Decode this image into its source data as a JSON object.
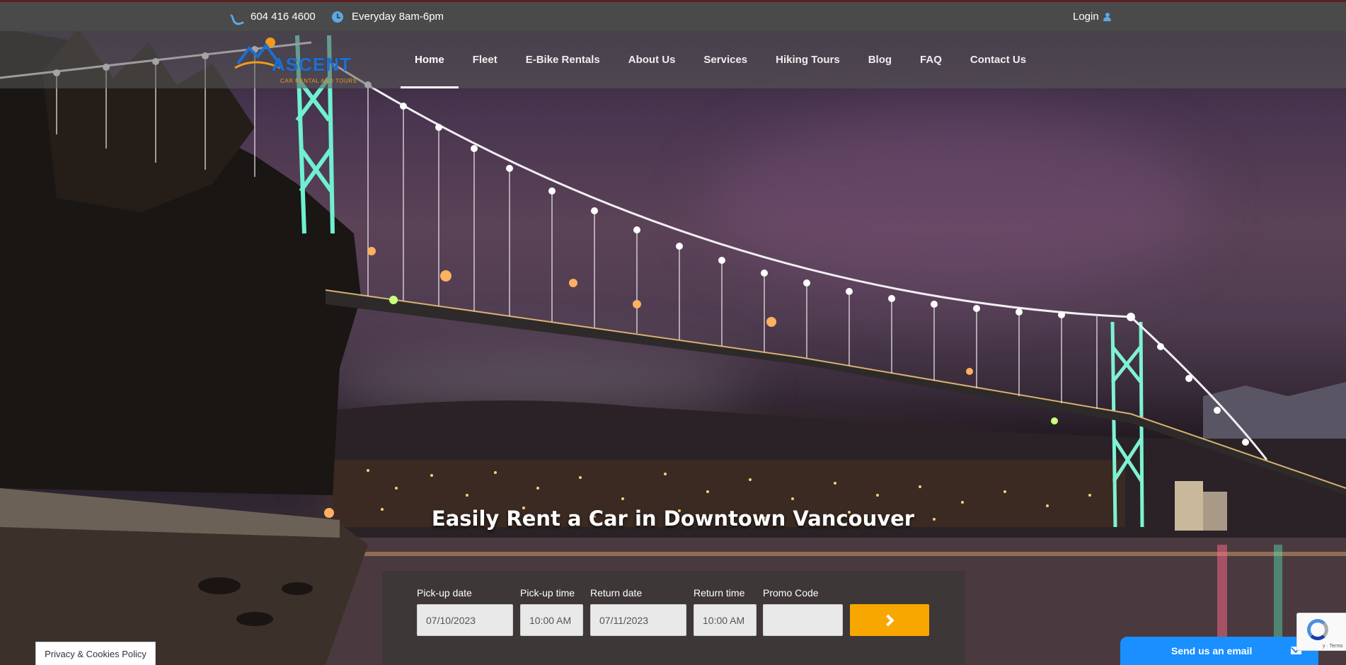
{
  "topbar": {
    "phone": "604 416 4600",
    "hours": "Everyday 8am-6pm",
    "login": "Login",
    "icons": [
      "phone-icon",
      "clock-icon",
      "user-icon"
    ],
    "accent_color": "#5aa9e6"
  },
  "logo": {
    "word": "ASCENT",
    "tagline": "CAR RENTAL AND TOURS"
  },
  "nav": {
    "items": [
      {
        "label": "Home",
        "active": true
      },
      {
        "label": "Fleet"
      },
      {
        "label": "E-Bike Rentals"
      },
      {
        "label": "About Us"
      },
      {
        "label": "Services"
      },
      {
        "label": "Hiking Tours"
      },
      {
        "label": "Blog"
      },
      {
        "label": "FAQ"
      },
      {
        "label": "Contact Us"
      }
    ]
  },
  "hero": {
    "headline": "Easily Rent a Car in Downtown Vancouver"
  },
  "booking": {
    "pickup_date": {
      "label": "Pick-up date",
      "value": "07/10/2023"
    },
    "pickup_time": {
      "label": "Pick-up time",
      "value": "10:00 AM"
    },
    "return_date": {
      "label": "Return date",
      "value": "07/11/2023"
    },
    "return_time": {
      "label": "Return time",
      "value": "10:00 AM"
    },
    "promo": {
      "label": "Promo Code",
      "value": ""
    },
    "submit_icon": "chevron-right-icon",
    "submit_color": "#f7a700"
  },
  "footer": {
    "privacy": "Privacy & Cookies Policy",
    "email_widget": "Send us an email",
    "email_widget_color": "#1a8fff",
    "recaptcha_terms": "y · Terms"
  }
}
